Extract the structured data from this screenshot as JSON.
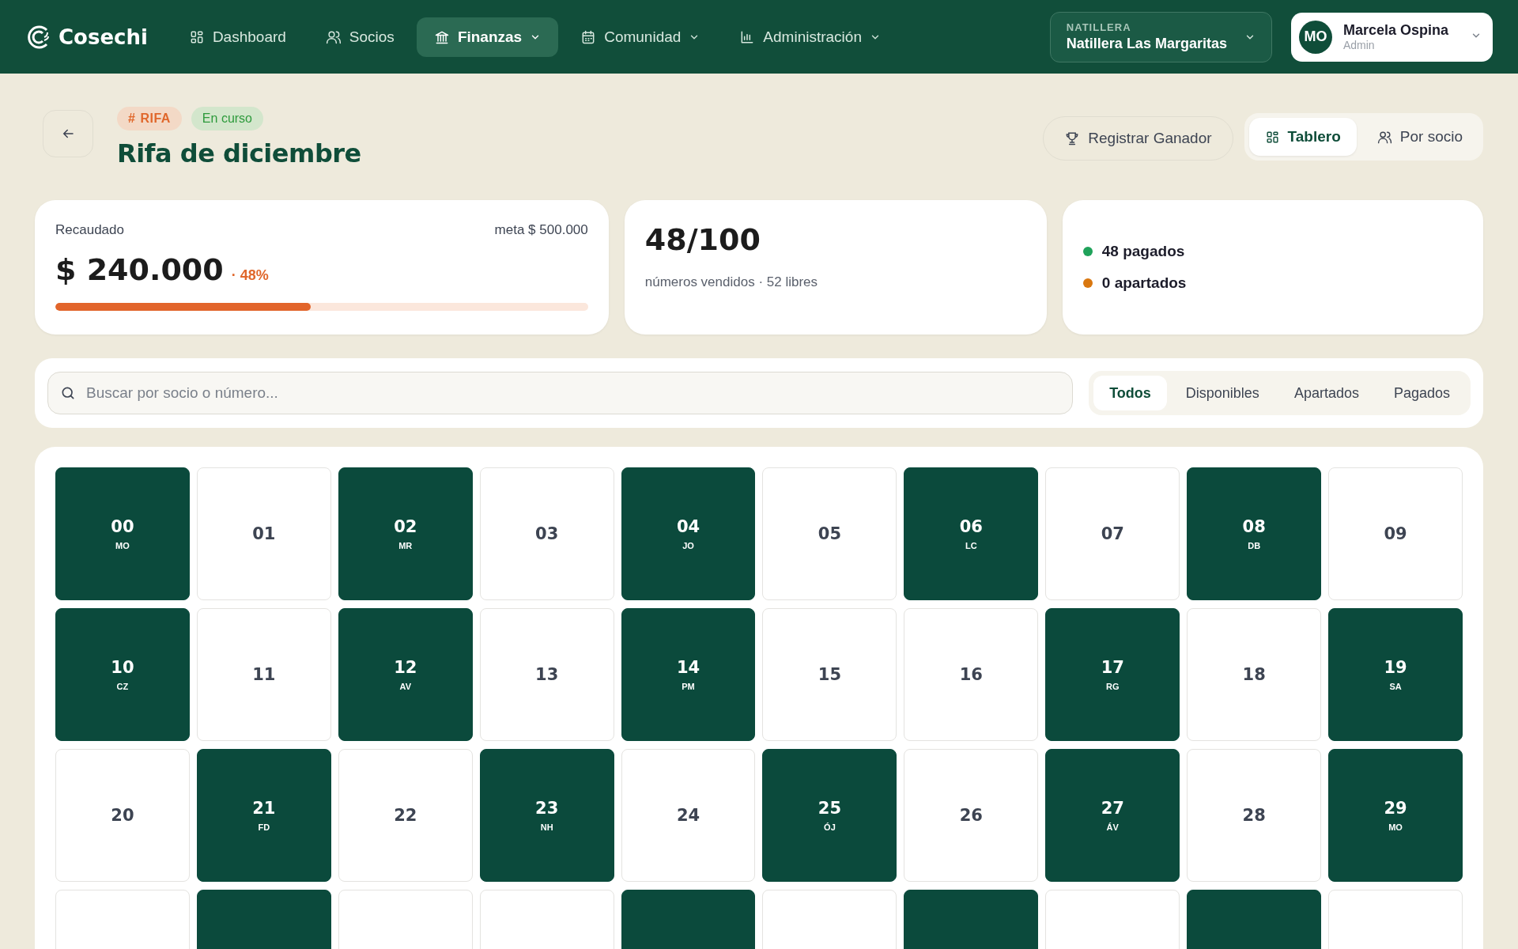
{
  "brand": {
    "name": "Cosechi"
  },
  "nav": [
    {
      "label": "Dashboard",
      "selected": false,
      "dropdown": false
    },
    {
      "label": "Socios",
      "selected": false,
      "dropdown": false
    },
    {
      "label": "Finanzas",
      "selected": true,
      "dropdown": true
    },
    {
      "label": "Comunidad",
      "selected": false,
      "dropdown": true
    },
    {
      "label": "Administración",
      "selected": false,
      "dropdown": true
    }
  ],
  "group_selector": {
    "label": "NATILLERA",
    "value": "Natillera Las Margaritas"
  },
  "user": {
    "initials": "MO",
    "name": "Marcela Ospina",
    "role": "Admin"
  },
  "header": {
    "tags": [
      {
        "kind": "type",
        "symbol": "#",
        "label": "RIFA"
      },
      {
        "kind": "status",
        "label": "En curso"
      }
    ],
    "title": "Rifa de diciembre",
    "action": "Registrar Ganador",
    "views": [
      {
        "label": "Tablero",
        "selected": true
      },
      {
        "label": "Por socio",
        "selected": false
      }
    ]
  },
  "summary": {
    "collected": {
      "label": "Recaudado",
      "goal": "meta $ 500.000",
      "amount": "$ 240.000",
      "percent": "· 48%",
      "level": 0.48
    },
    "sold": {
      "count": "48/100",
      "caption": "números vendidos · 52 libres"
    },
    "legend": [
      {
        "label": "48 pagados",
        "color": "#1fa25a"
      },
      {
        "label": "0 apartados",
        "color": "#d9770f"
      }
    ]
  },
  "search": {
    "placeholder": "Buscar por socio o número..."
  },
  "filters": [
    {
      "label": "Todos",
      "selected": true
    },
    {
      "label": "Disponibles",
      "selected": false
    },
    {
      "label": "Apartados",
      "selected": false
    },
    {
      "label": "Pagados",
      "selected": false
    }
  ],
  "tickets": [
    {
      "number": "00",
      "holder": "MO",
      "paid": true
    },
    {
      "number": "01",
      "paid": false
    },
    {
      "number": "02",
      "holder": "MR",
      "paid": true
    },
    {
      "number": "03",
      "paid": false
    },
    {
      "number": "04",
      "holder": "JO",
      "paid": true
    },
    {
      "number": "05",
      "paid": false
    },
    {
      "number": "06",
      "holder": "LC",
      "paid": true
    },
    {
      "number": "07",
      "paid": false
    },
    {
      "number": "08",
      "holder": "DB",
      "paid": true
    },
    {
      "number": "09",
      "paid": false
    },
    {
      "number": "10",
      "holder": "CZ",
      "paid": true
    },
    {
      "number": "11",
      "paid": false
    },
    {
      "number": "12",
      "holder": "AV",
      "paid": true
    },
    {
      "number": "13",
      "paid": false
    },
    {
      "number": "14",
      "holder": "PM",
      "paid": true
    },
    {
      "number": "15",
      "paid": false
    },
    {
      "number": "16",
      "paid": false
    },
    {
      "number": "17",
      "holder": "RG",
      "paid": true
    },
    {
      "number": "18",
      "paid": false
    },
    {
      "number": "19",
      "holder": "SA",
      "paid": true
    },
    {
      "number": "20",
      "paid": false
    },
    {
      "number": "21",
      "holder": "FD",
      "paid": true
    },
    {
      "number": "22",
      "paid": false
    },
    {
      "number": "23",
      "holder": "NH",
      "paid": true
    },
    {
      "number": "24",
      "paid": false
    },
    {
      "number": "25",
      "holder": "ÓJ",
      "paid": true
    },
    {
      "number": "26",
      "paid": false
    },
    {
      "number": "27",
      "holder": "ÁV",
      "paid": true
    },
    {
      "number": "28",
      "paid": false
    },
    {
      "number": "29",
      "holder": "MO",
      "paid": true
    },
    {
      "paid": false
    },
    {
      "paid": true
    },
    {
      "paid": false
    },
    {
      "paid": false
    },
    {
      "paid": true
    },
    {
      "paid": false
    },
    {
      "paid": true
    },
    {
      "paid": false
    },
    {
      "paid": true
    },
    {
      "paid": false
    }
  ]
}
